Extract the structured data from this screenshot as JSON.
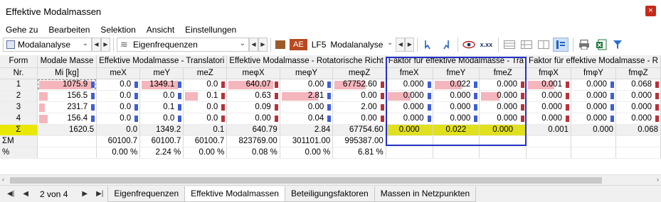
{
  "window": {
    "title": "Effektive Modalmassen",
    "close_label": "×"
  },
  "menu": [
    "Gehe zu",
    "Bearbeiten",
    "Selektion",
    "Ansicht",
    "Einstellungen"
  ],
  "toolbar": {
    "analysis_combo": "Modalanalyse",
    "results_combo": "Eigenfrequenzen",
    "lc_tag": "AE",
    "lc_id": "LF5",
    "lc_combo": "Modalanalyse",
    "calc_icon_label": "x.xx"
  },
  "table": {
    "headers1": [
      "Form",
      "Modale Masse",
      "Effektive Modalmasse - Translatori",
      "Effektive Modalmasse - Rotatorische Richt",
      "Faktor für effektive Modalmasse - Tra",
      "Faktor für effektive Modalmasse - R"
    ],
    "headers2": [
      "Nr.",
      "Mi [kg]",
      "meX",
      "meY",
      "meZ",
      "meφX",
      "meφY",
      "meφZ",
      "fmeX",
      "fmeY",
      "fmeZ",
      "fmφX",
      "fmφY",
      "fmφZ"
    ],
    "rows": [
      {
        "nr": "1",
        "cells": [
          "1075.9",
          "0.0",
          "1349.1",
          "0.0",
          "640.07",
          "0.00",
          "67752.60",
          "0.000",
          "0.022",
          "0.000",
          "0.001",
          "0.000",
          "0.068"
        ]
      },
      {
        "nr": "2",
        "cells": [
          "156.5",
          "0.0",
          "0.0",
          "0.1",
          "0.63",
          "2.81",
          "0.00",
          "0.000",
          "0.000",
          "0.000",
          "0.000",
          "0.000",
          "0.000"
        ]
      },
      {
        "nr": "3",
        "cells": [
          "231.7",
          "0.0",
          "0.1",
          "0.0",
          "0.09",
          "0.00",
          "2.00",
          "0.000",
          "0.000",
          "0.000",
          "0.000",
          "0.000",
          "0.000"
        ]
      },
      {
        "nr": "4",
        "cells": [
          "156.4",
          "0.0",
          "0.0",
          "0.0",
          "0.00",
          "0.04",
          "0.00",
          "0.000",
          "0.000",
          "0.000",
          "0.000",
          "0.000",
          "0.000"
        ]
      }
    ],
    "sum_row": {
      "label": "Σ",
      "cells": [
        "1620.5",
        "0.0",
        "1349.2",
        "0.1",
        "640.79",
        "2.84",
        "67754.60",
        "0.000",
        "0.022",
        "0.000",
        "0.001",
        "0.000",
        "0.068"
      ]
    },
    "summ_row": {
      "label": "ΣM",
      "cells": [
        "",
        "60100.7",
        "60100.7",
        "60100.7",
        "823769.00",
        "301101.00",
        "995387.00",
        "",
        "",
        "",
        "",
        "",
        ""
      ]
    },
    "pct_row": {
      "label": "%",
      "cells": [
        "",
        "0.00 %",
        "2.24 %",
        "0.00 %",
        "0.08 %",
        "0.00 %",
        "6.81 %",
        "",
        "",
        "",
        "",
        "",
        ""
      ]
    }
  },
  "tabs": {
    "pager": "2 von 4",
    "items": [
      "Eigenfrequenzen",
      "Effektive Modalmassen",
      "Beteiligungsfaktoren",
      "Massen in Netzpunkten"
    ],
    "active_index": 1
  },
  "colors": {
    "bar": "#f4b6bc",
    "sum_highlight": "#e8e800",
    "frame": "#2330c8"
  }
}
